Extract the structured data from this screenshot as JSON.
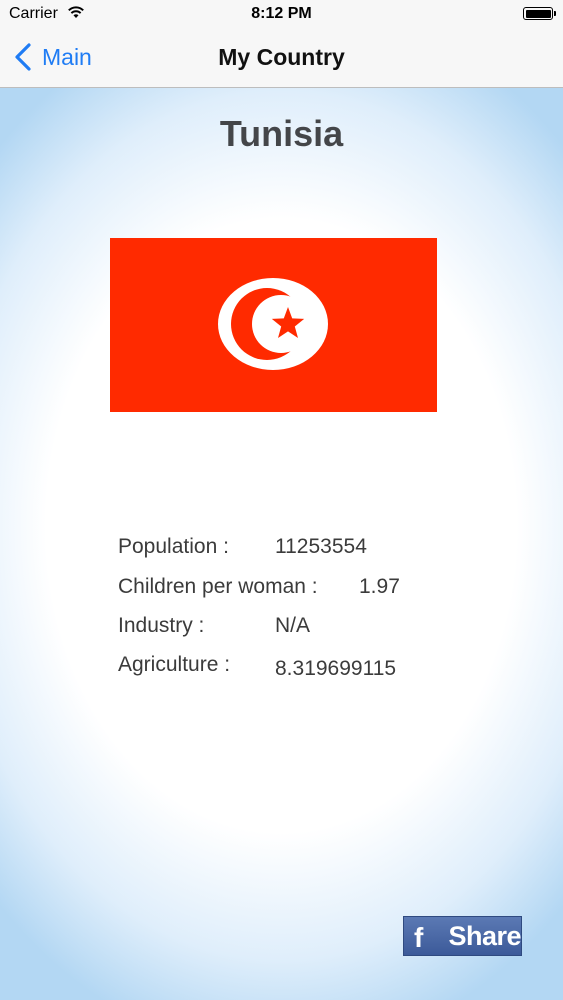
{
  "status_bar": {
    "carrier": "Carrier",
    "time": "8:12 PM",
    "battery_level": 1.0
  },
  "nav": {
    "back_label": "Main",
    "title": "My Country"
  },
  "country": {
    "name": "Tunisia",
    "flag_colors": {
      "field": "#ff2a00",
      "disc": "#ffffff",
      "crescent_star": "#ff2a00"
    }
  },
  "stats": [
    {
      "label": "Population :",
      "value": "11253554"
    },
    {
      "label": "Children per woman :",
      "value": "1.97"
    },
    {
      "label": "Industry :",
      "value": "N/A"
    },
    {
      "label": "Agriculture :",
      "value": "8.319699115"
    }
  ],
  "share_button": {
    "icon": "facebook-icon",
    "label": "Share",
    "color": "#3c5a99"
  },
  "colors": {
    "accent": "#1f7cf4",
    "background_edge": "#b3d7f3"
  }
}
